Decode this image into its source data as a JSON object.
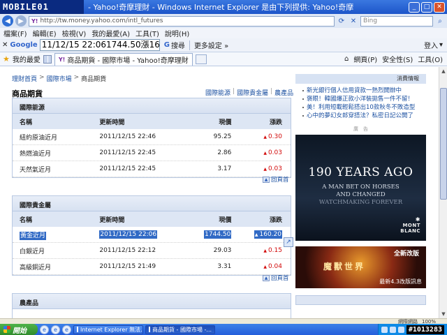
{
  "window": {
    "logo_text": "MOBILE01",
    "title": "- Yahoo!奇摩理財 - Windows Internet Explorer 是由下列提供: Yahoo!奇摩",
    "btn_min": "_",
    "btn_max": "□",
    "btn_close": "✕"
  },
  "address": {
    "url": "http://tw.money.yahoo.com/intl_futures",
    "bing_placeholder": "Bing"
  },
  "menu": [
    "檔案(F)",
    "編輯(E)",
    "檢視(V)",
    "我的最愛(A)",
    "工具(T)",
    "說明(H)"
  ],
  "google_toolbar": {
    "label": "Google",
    "query": "11/12/15 22:061744.50漲160.20",
    "search_label": "搜尋",
    "more_label": "更多設定 »",
    "signin_label": "登入"
  },
  "tabbar": {
    "favorites_label": "我的最愛",
    "tab_title": "商品期貨 - 國際市場 - Yahoo!奇摩理財",
    "commands": [
      "網頁(P)",
      "安全性(S)",
      "工具(O)"
    ]
  },
  "breadcrumb": {
    "items": [
      "理財首頁",
      "國際市場",
      "商品期貨"
    ],
    "separator": ">"
  },
  "page_title": "商品期貨",
  "top_links": [
    "國際能源",
    "國際貴金屬",
    "農產品"
  ],
  "top_links_sep": "|",
  "columns": {
    "name": "名稱",
    "time": "更新時間",
    "price": "現價",
    "change": "漲跌"
  },
  "sections": [
    {
      "title": "國際能源",
      "rows": [
        {
          "name": "紐約原油近月",
          "time": "2011/12/15 22:46",
          "price": "95.25",
          "change": "0.30"
        },
        {
          "name": "熱燃油近月",
          "time": "2011/12/15 22:45",
          "price": "2.86",
          "change": "0.03"
        },
        {
          "name": "天然氣近月",
          "time": "2011/12/15 22:45",
          "price": "3.17",
          "change": "0.03"
        }
      ]
    },
    {
      "title": "國際貴金屬",
      "rows": [
        {
          "name": "黃金近月",
          "time": "2011/12/15 22:06",
          "price": "1744.50",
          "change": "160.20",
          "selected": true
        },
        {
          "name": "白銀近月",
          "time": "2011/12/15 22:12",
          "price": "29.03",
          "change": "0.15"
        },
        {
          "name": "高級銅近月",
          "time": "2011/12/15 21:49",
          "price": "3.31",
          "change": "0.04"
        }
      ]
    },
    {
      "title": "農產品",
      "rows": []
    }
  ],
  "back_to_top": "回頁首",
  "sidebar": {
    "news_header": "消費情報",
    "news": [
      "新光銀行個人信用貸款一熱烈開辦中",
      "褒眼！韓國爆正款小洋裝拋售一件不留！",
      "美！利用短載輕鬆搭出10款秋冬不敗造型",
      "心中的夢幻女郎穿搭法？私密日記公開了"
    ],
    "ad_label": "廣　告",
    "ad1": {
      "headline": "190 YEARS AGO",
      "line1": "A MAN BET ON HORSES",
      "line2": "AND CHANGED",
      "line3": "WATCHMAKING FOREVER",
      "brand1": "MONT",
      "brand2": "BLANC"
    },
    "ad2": {
      "tag": "全新改版",
      "title": "魔獸世界",
      "footer": "最新4.3改版訊息"
    }
  },
  "statusbar": {
    "zone": "網際網路",
    "zoom": "100%"
  },
  "taskbar": {
    "start_label": "開始",
    "tasks": [
      "Internet Explorer 無法...",
      "商品期貨 - 國際市場 -..."
    ],
    "watermark": "#1013283"
  }
}
